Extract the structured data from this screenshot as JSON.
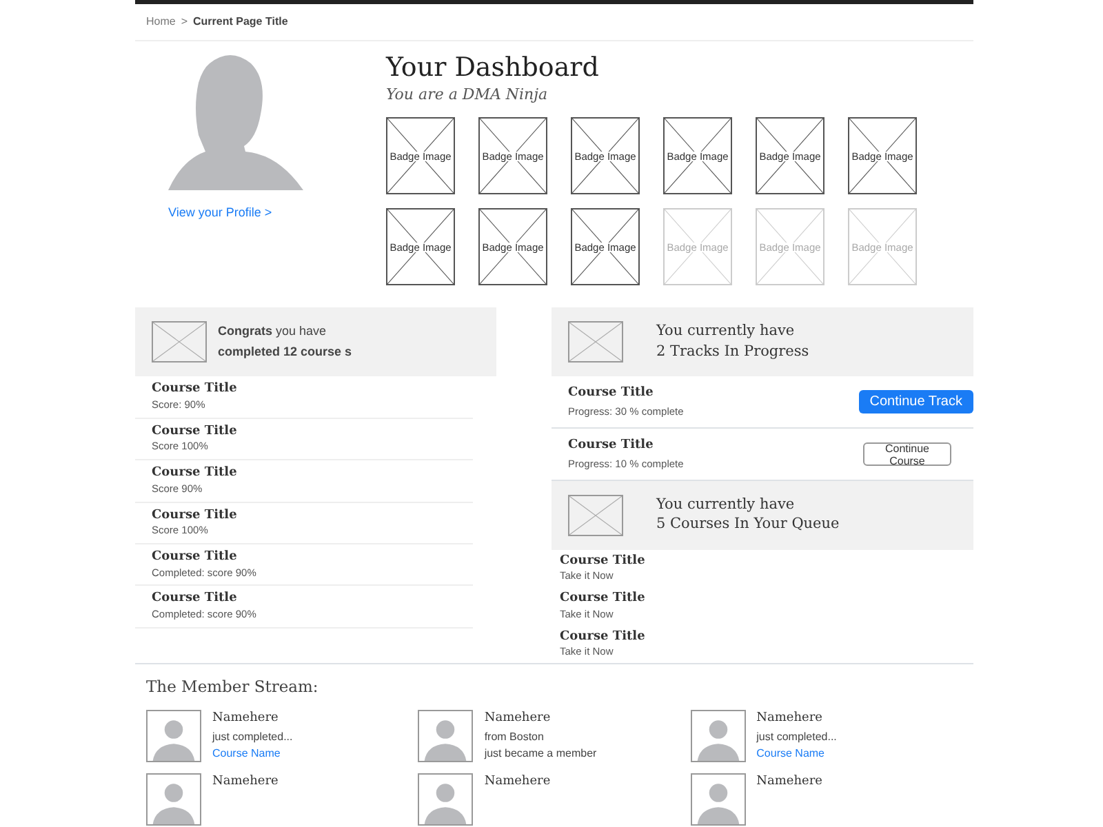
{
  "breadcrumb": {
    "home": "Home",
    "separator": ">",
    "current": "Current Page Title"
  },
  "profile": {
    "link": "View your Profile >"
  },
  "header": {
    "title": "Your Dashboard",
    "subtitle": "You are a DMA Ninja"
  },
  "badges": [
    {
      "label": "Badge Image",
      "earned": true
    },
    {
      "label": "Badge Image",
      "earned": true
    },
    {
      "label": "Badge Image",
      "earned": true
    },
    {
      "label": "Badge Image",
      "earned": true
    },
    {
      "label": "Badge Image",
      "earned": true
    },
    {
      "label": "Badge Image",
      "earned": true
    },
    {
      "label": "Badge Image",
      "earned": true
    },
    {
      "label": "Badge Image",
      "earned": true
    },
    {
      "label": "Badge Image",
      "earned": true
    },
    {
      "label": "Badge Image",
      "earned": false
    },
    {
      "label": "Badge Image",
      "earned": false
    },
    {
      "label": "Badge Image",
      "earned": false
    }
  ],
  "completed": {
    "heading": "**Congrats** you have **completed 12 course s**",
    "courses": [
      {
        "title": "Course Title",
        "detail": "Score: 90%"
      },
      {
        "title": "Course Title",
        "detail": "Score 100%"
      },
      {
        "title": "Course Title",
        "detail": "Score 90%"
      },
      {
        "title": "Course Title",
        "detail": "Score 100%"
      },
      {
        "title": "Course Title",
        "detail": "Completed: score 90%"
      },
      {
        "title": "Course Title",
        "detail": "Completed: score 90%"
      }
    ]
  },
  "tracks": {
    "heading": [
      "You currently have",
      "2 Tracks In Progress"
    ],
    "items": [
      {
        "title": "Course Title",
        "detail": "Progress: 30 % complete",
        "button": "Continue Track",
        "kind": "primary"
      },
      {
        "title": "Course Title",
        "detail": "Progress: 10 % complete",
        "button": "Continue Course",
        "kind": "secondary"
      }
    ]
  },
  "queue": {
    "heading": [
      "You currently have",
      "5 Courses In Your Queue"
    ],
    "items": [
      {
        "title": "Course Title",
        "detail": "Take it Now"
      },
      {
        "title": "Course Title",
        "detail": "Take it Now"
      },
      {
        "title": "Course Title",
        "detail": "Take it Now"
      }
    ]
  },
  "member_stream": {
    "title": "The Member Stream:",
    "members": [
      {
        "name": "Namehere",
        "lines": [
          {
            "text": "just completed...",
            "kind": "text"
          },
          {
            "text": "Course Name",
            "kind": "link"
          }
        ]
      },
      {
        "name": "Namehere",
        "lines": [
          {
            "text": "from Boston",
            "kind": "text"
          },
          {
            "text": "just became a member",
            "kind": "text"
          }
        ]
      },
      {
        "name": "Namehere",
        "lines": [
          {
            "text": "just completed...",
            "kind": "text"
          },
          {
            "text": "Course Name",
            "kind": "link"
          }
        ]
      },
      {
        "name": "Namehere"
      },
      {
        "name": "Namehere"
      },
      {
        "name": "Namehere"
      }
    ]
  }
}
